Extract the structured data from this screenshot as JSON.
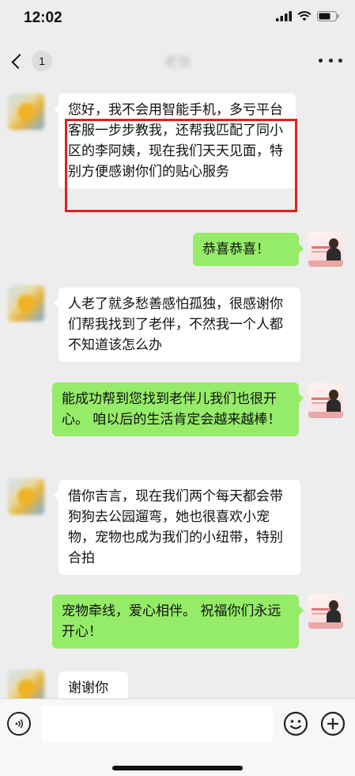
{
  "status_bar": {
    "time": "12:02"
  },
  "nav": {
    "back_badge": "1",
    "title": "老张"
  },
  "messages": [
    {
      "side": "left",
      "text": "您好，我不会用智能手机，多亏平台客服一步步教我，还帮我匹配了同小区的李阿姨，现在我们天天见面，特别方便感谢你们的贴心服务"
    },
    {
      "side": "right",
      "text": "恭喜恭喜！"
    },
    {
      "side": "left",
      "text": "人老了就多愁善感怕孤独，很感谢你们帮我找到了老伴，不然我一个人都不知道该怎么办"
    },
    {
      "side": "right",
      "text": "能成功帮到您找到老伴儿我们也很开心。 咱以后的生活肯定会越来越棒！"
    },
    {
      "side": "left",
      "text": "借你吉言，现在我们两个每天都会带狗狗去公园遛弯，她也很喜欢小宠物，宠物也成为我们的小纽带，特别合拍"
    },
    {
      "side": "right",
      "text": "宠物牵线，爱心相伴。 祝福你们永远开心！"
    },
    {
      "side": "left",
      "text": "谢谢你"
    }
  ],
  "input": {
    "value": ""
  },
  "icons": [
    "signal-icon",
    "wifi-icon",
    "battery-icon",
    "voice-icon",
    "emoji-icon",
    "plus-icon"
  ]
}
